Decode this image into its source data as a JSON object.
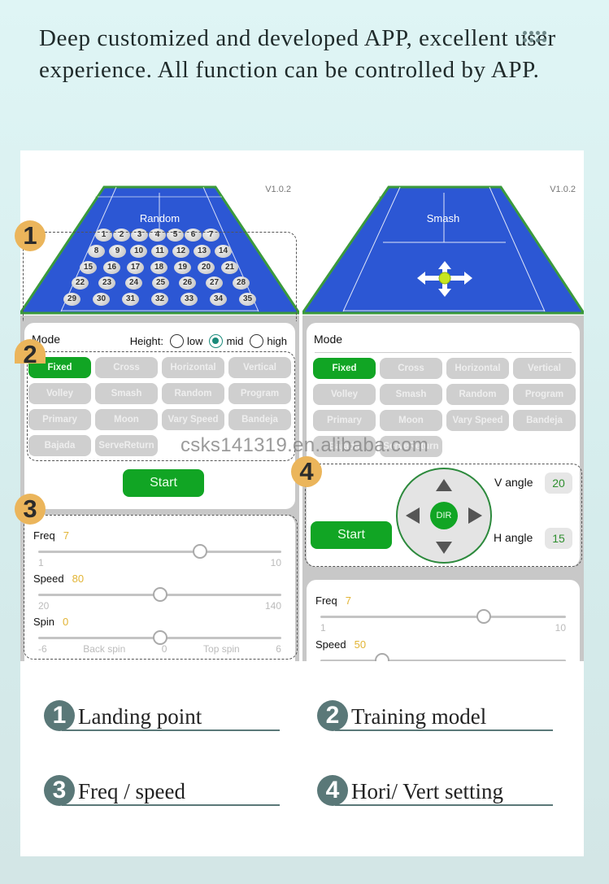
{
  "intro": {
    "text": "Deep customized and developed APP, excellent user experience. All function can be controlled by APP.",
    "menu_icon": "grid-dots-icon"
  },
  "watermark": "csks141319.en.alibaba.com",
  "left_phone": {
    "version": "V1.0.2",
    "court_label": "Random",
    "landing_points": [
      "1",
      "2",
      "3",
      "4",
      "5",
      "6",
      "7",
      "8",
      "9",
      "10",
      "11",
      "12",
      "13",
      "14",
      "15",
      "16",
      "17",
      "18",
      "19",
      "20",
      "21",
      "22",
      "23",
      "24",
      "25",
      "26",
      "27",
      "28",
      "29",
      "30",
      "31",
      "32",
      "33",
      "34",
      "35"
    ],
    "mode_label": "Mode",
    "height_label": "Height:",
    "height_options": [
      {
        "label": "low",
        "selected": false
      },
      {
        "label": "mid",
        "selected": true
      },
      {
        "label": "high",
        "selected": false
      }
    ],
    "modes": [
      "Fixed",
      "Cross",
      "Horizontal",
      "Vertical",
      "Volley",
      "Smash",
      "Random",
      "Program",
      "Primary",
      "Moon",
      "Vary Speed",
      "Bandeja",
      "Bajada",
      "ServeReturn"
    ],
    "active_mode": "Fixed",
    "start_label": "Start",
    "sliders": [
      {
        "label": "Freq",
        "value": "7",
        "min": "1",
        "max": "10",
        "fraction": 0.667
      },
      {
        "label": "Speed",
        "value": "80",
        "min": "20",
        "max": "140",
        "fraction": 0.5
      },
      {
        "label": "Spin",
        "value": "0",
        "min": "-6",
        "max": "6",
        "mid_label": "0",
        "left_label": "Back spin",
        "right_label": "Top spin",
        "fraction": 0.5
      }
    ]
  },
  "right_phone": {
    "version": "V1.0.2",
    "court_label": "Smash",
    "mode_label": "Mode",
    "modes": [
      "Fixed",
      "Cross",
      "Horizontal",
      "Vertical",
      "Volley",
      "Smash",
      "Random",
      "Program",
      "Primary",
      "Moon",
      "Vary Speed",
      "Bandeja",
      "Bajada",
      "ServeReturn"
    ],
    "active_mode": "Fixed",
    "start_label": "Start",
    "dir_label": "DIR",
    "v_angle_label": "V angle",
    "v_angle_value": "20",
    "h_angle_label": "H angle",
    "h_angle_value": "15",
    "sliders": [
      {
        "label": "Freq",
        "value": "7",
        "min": "1",
        "max": "10",
        "fraction": 0.667
      },
      {
        "label": "Speed",
        "value": "50",
        "min": "20",
        "max": "140",
        "fraction": 0.25
      }
    ]
  },
  "callouts": [
    "1",
    "2",
    "3",
    "4"
  ],
  "legend": [
    {
      "num": "1",
      "text": "Landing point"
    },
    {
      "num": "2",
      "text": "Training model"
    },
    {
      "num": "3",
      "text": "Freq / speed"
    },
    {
      "num": "4",
      "text": "Hori/ Vert setting"
    }
  ]
}
